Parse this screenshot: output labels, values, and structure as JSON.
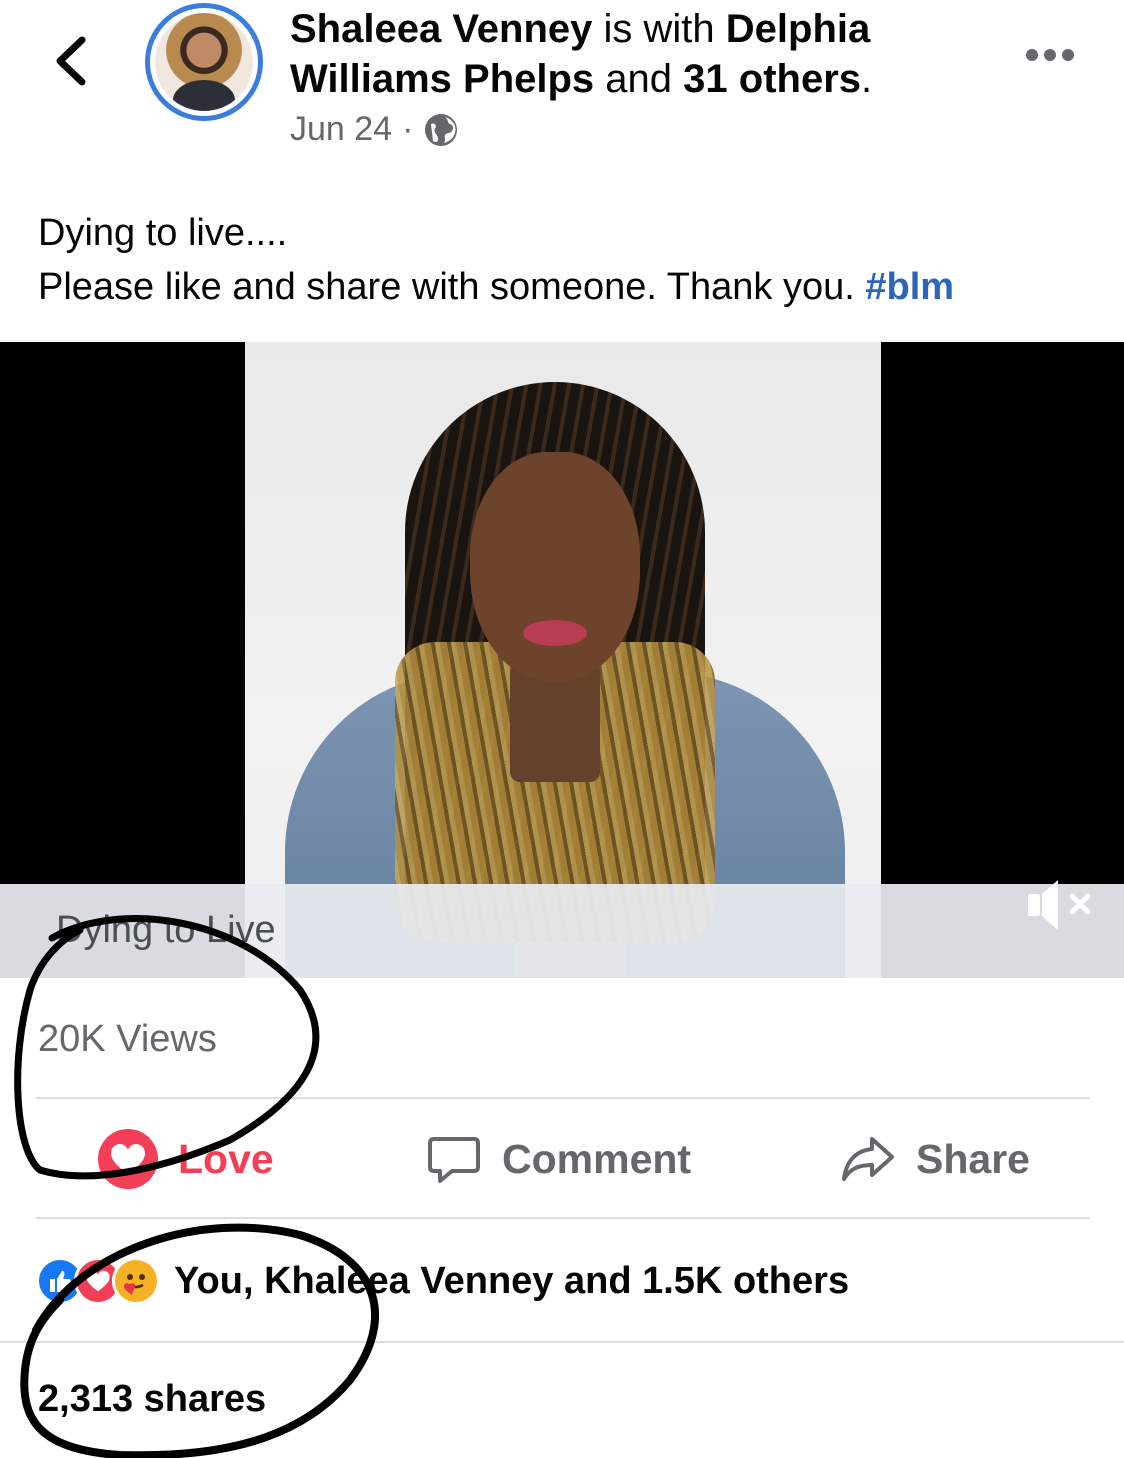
{
  "header": {
    "author": "Shaleea Venney",
    "with_word": " is with ",
    "tagged": "Delphia Williams Phelps",
    "and_word": " and ",
    "others": "31 others",
    "period": ".",
    "date": "Jun 24",
    "separator": "·",
    "privacy_icon": "globe-icon",
    "back_icon": "chevron-left-icon",
    "more_icon": "more-dots-icon"
  },
  "post": {
    "line1": "Dying to live....",
    "line2": "Please like and share with someone. Thank you. ",
    "hashtag": "#blm"
  },
  "video": {
    "caption": "Dying to Live",
    "mute_icon": "speaker-muted-icon"
  },
  "stats": {
    "views": "20K Views",
    "reactions_text": "You, Khaleea Venney and 1.5K others",
    "shares": "2,313 shares"
  },
  "actions": {
    "love": "Love",
    "comment": "Comment",
    "share": "Share"
  },
  "colors": {
    "accent": "#2d64bc",
    "love": "#f33e58",
    "like": "#1877f2",
    "muted_text": "#65676b"
  }
}
